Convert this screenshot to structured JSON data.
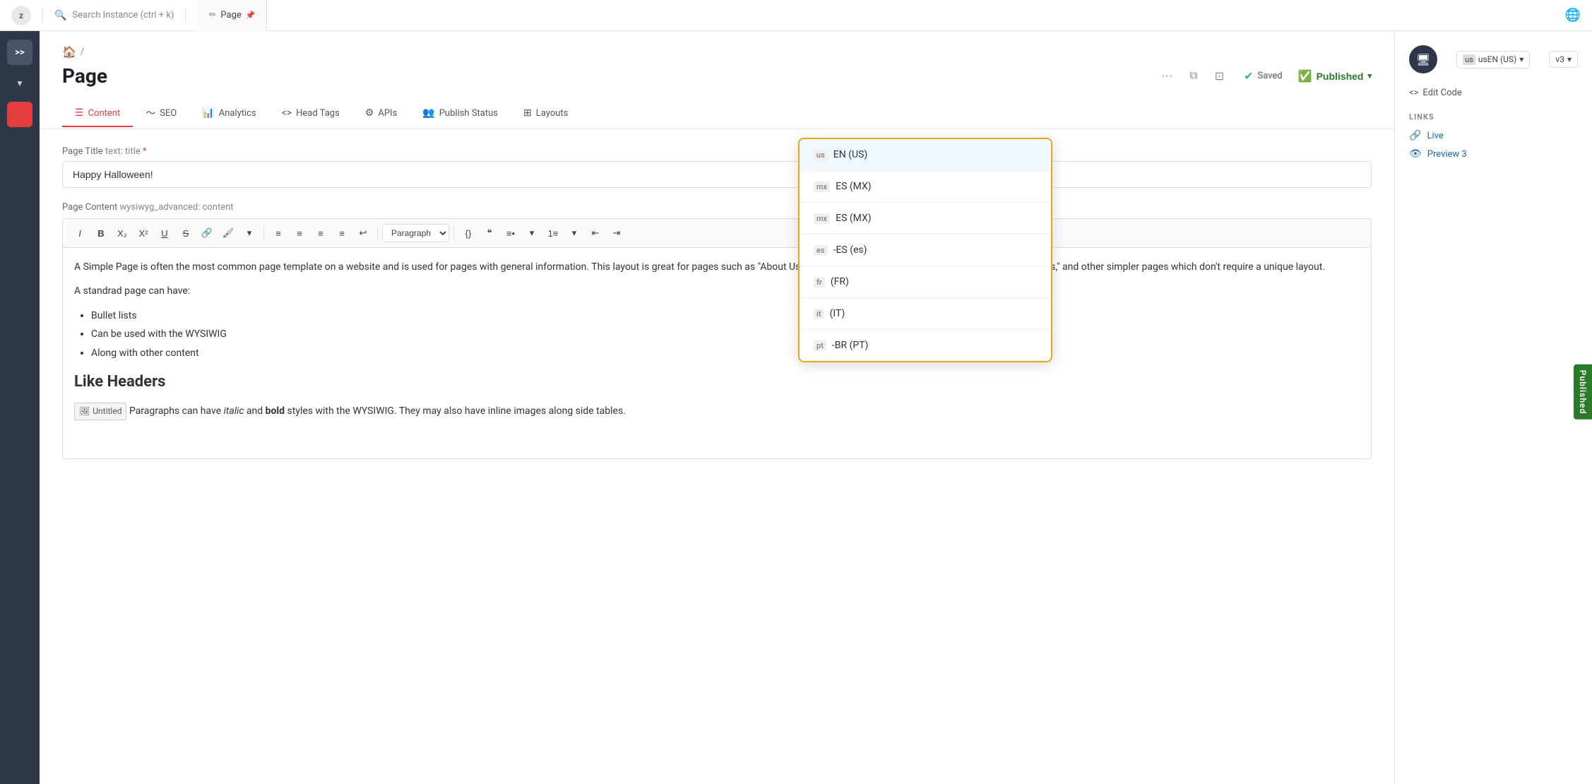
{
  "topbar": {
    "logo_text": "z",
    "search_placeholder": "Search Instance (ctrl + k)",
    "tab_label": "Page",
    "shortcuts_icon": "≡",
    "edit_icon": "✏",
    "pin_icon": "📌"
  },
  "breadcrumb": {
    "home": "🏠",
    "separator": "/"
  },
  "page": {
    "title": "Page",
    "saved_label": "Saved",
    "published_label": "Published"
  },
  "nav_tabs": [
    {
      "id": "content",
      "label": "Content",
      "icon": "☰",
      "active": true
    },
    {
      "id": "seo",
      "label": "SEO",
      "icon": "📈"
    },
    {
      "id": "analytics",
      "label": "Analytics",
      "icon": "📊"
    },
    {
      "id": "head-tags",
      "label": "Head Tags",
      "icon": "<>"
    },
    {
      "id": "apis",
      "label": "APIs",
      "icon": "⚙"
    },
    {
      "id": "publish-status",
      "label": "Publish Status",
      "icon": "👥"
    },
    {
      "id": "layouts",
      "label": "Layouts",
      "icon": "⊞"
    }
  ],
  "fields": {
    "page_title_label": "Page Title",
    "page_title_type": "text: title",
    "page_title_required": "*",
    "page_title_value": "Happy Halloween!",
    "page_content_label": "Page Content",
    "page_content_type": "wysiwyg_advanced: content"
  },
  "wysiwyg": {
    "toolbar": [
      "I",
      "B",
      "X₂",
      "X²",
      "U",
      "S",
      "🔗",
      "🖌",
      "▾",
      "≡",
      "≡",
      "≡",
      "≡",
      "↩",
      "{}",
      "❝",
      "•≡",
      "▾",
      "1≡",
      "▾",
      "⬅",
      "➡"
    ],
    "paragraph_select": "Paragraph",
    "content_p1": "A Simple Page is often the most common page template on a website and is used for pages with general information. This layout is great for pages such as \"About Us,\" \"Mission Statement,\" \"Basic Team Pages,\" \"Service pages,\" and other simpler pages which don't require a unique layout.",
    "content_p2": "A standrad page can have:",
    "bullet_items": [
      "Bullet lists",
      "Can be used with the WYSIWIG",
      "Along with other content"
    ],
    "header": "Like Headers",
    "para_with_styles": "Paragraphs can have ",
    "italic_word": "italic",
    "middle_text": " and ",
    "bold_word": "bold",
    "end_text": " styles with the WYSIWIG. They may also have inline images along side tables.",
    "untitled_image": "Untitled"
  },
  "right_panel": {
    "lang_label": "usEN (US)",
    "version_label": "v3",
    "edit_code_label": "Edit Code",
    "links_section_title": "LINKS",
    "link_live": "Live",
    "link_preview": "Preview 3"
  },
  "language_dropdown": {
    "items": [
      {
        "id": "en-us",
        "flag": "us",
        "label": "EN (US)",
        "selected": true
      },
      {
        "id": "es-mx-1",
        "flag": "mx",
        "label": "ES (MX)",
        "selected": false
      },
      {
        "id": "es-mx-2",
        "flag": "mx",
        "label": "ES (MX)",
        "selected": false
      },
      {
        "id": "es-es",
        "flag": "es",
        "label": "-ES (es)",
        "selected": false
      },
      {
        "id": "fr",
        "flag": "fr",
        "label": "(FR)",
        "selected": false
      },
      {
        "id": "it",
        "flag": "it",
        "label": "(IT)",
        "selected": false
      },
      {
        "id": "pt-br",
        "flag": "pt",
        "label": "-BR (PT)",
        "selected": false
      }
    ]
  },
  "published_badge": "Published"
}
